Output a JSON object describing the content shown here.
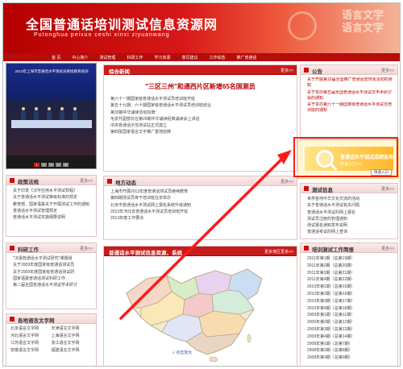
{
  "header": {
    "title": "全国普通话培训测试信息资源网",
    "subtitle": "Putonghua peixun ceshi xinxi ziyuanwang",
    "deco_text": [
      "语言文字",
      "语言文字"
    ]
  },
  "nav": [
    "首 页",
    "中心简介",
    "测试管理",
    "科研工作",
    "学习资源",
    "意见建议",
    "工作动态",
    "推广普通话"
  ],
  "photo": {
    "caption": "2013年上海市普通话水平测试员继续教育培训",
    "dots": [
      "1",
      "2",
      "3",
      "4",
      "5"
    ]
  },
  "main_news": {
    "title": "综合新闻",
    "more": "更多>>",
    "headline": "\"三区三州\"和通西片区新增65名国测员",
    "items": [
      "第六十一期国家级普通话水平测试员培训班开班",
      "第五十九期、六十期国家级普通话水平测试员培训班结业",
      "第30期中华诵读活动授牌",
      "毛泉升副部长在第29期中华诵读经典诵读会上讲话",
      "中央普通话示范测试站正式建立",
      "第四批国家语言文字推广基地授牌"
    ]
  },
  "notice": {
    "title": "公告",
    "more": "更多>>",
    "items": [
      "关于开展第16届全国推广普通话宣传周活动的通知",
      "关于举办第五届全国普通话水平测试员学术研讨会的通知",
      "关于举办第六十一期国家级普通话水平测试员培训班的通知"
    ]
  },
  "ad": {
    "title": "普通话水平测试成绩查询",
    "subtitle": "快速入口 >>",
    "button": "快速入口"
  },
  "recruit": {
    "title": "地方动态",
    "more": "更多>>",
    "items": [
      "上海市开展2013年度普通话测试员继续教育",
      "第四期测试员骨干培训班在京举办",
      "北京市普通话水平测试网上报名系统升级通知",
      "2013年河北省普通话水平测试员培训班开班",
      "2013年度工作要点"
    ]
  },
  "policy": {
    "title": "政策法规",
    "more": "更多>>",
    "items": [
      "关于印发《汉字应用水平测试规程》",
      "关于普通话水平测试等级标准的规定",
      "教育部、国家语委关于开展测试工作的通知",
      "普通话水平测试管理规定",
      "普通话水平测试实施纲要说明"
    ]
  },
  "link_lower": {
    "title": "测试信息",
    "more": "更多>>",
    "items": [
      "世界各地中华文化交流的活动",
      "关于普通话水平测试有关问题",
      "普通话水平测试的网上报名",
      "测试员注册的管理通知",
      "测试报名通知发布说明",
      "普通话考试的网上查询"
    ]
  },
  "mapbox": {
    "title": "普通话水平测试信息资源，系统",
    "more": "更多地区更多>>",
    "zoom_label": "点击放大"
  },
  "study": {
    "title": "科研工作",
    "more": "更多>>",
    "items": [
      "\"汉语普通话水平测试研究\"课题组",
      "关于2009年度国家级普通话测试员",
      "关于2009年度国家级普通话测试研",
      "国家语委普通话测试科研工作",
      "第二届全国普通话水平测试学术研讨"
    ]
  },
  "lang_sites": {
    "title": "各地语言文字网",
    "items": [
      "北京语言文字网",
      "天津语言文字网",
      "河北语言文字网",
      "上海语言文字网",
      "江苏语言文字网",
      "浙江语言文字网",
      "安徽语言文字网",
      "福建语言文字网"
    ]
  },
  "plan": {
    "title": "培训测试工作简报",
    "more": "更多>>",
    "items": [
      "2011年第1期（总第19期）",
      "2011年第2期（总第20期）",
      "2011年第3期（总第21期）",
      "2011年第4期（总第22期）",
      "2010年第1期（总第15期）",
      "2010年第2期（总第16期）",
      "2010年第3期（总第17期）",
      "2010年第4期（总第18期）",
      "2009年第1期（总第11期）",
      "2009年第2期（总第12期）",
      "2009年第3期（总第13期）",
      "2009年第4期（总第14期）",
      "2008年第1期（总第7期）",
      "2008年第2期（总第8期）",
      "2008年第3期（总第9期）"
    ]
  },
  "colors": {
    "brand_red": "#c81010",
    "annotation_red": "#ff1a1a"
  }
}
